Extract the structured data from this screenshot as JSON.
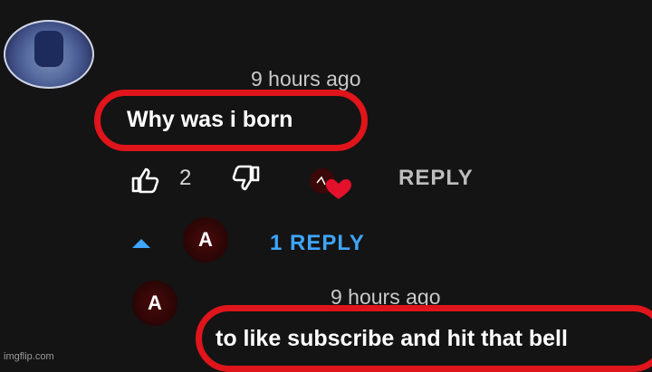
{
  "comment": {
    "timestamp": "9 hours ago",
    "text": "Why was i born",
    "like_count": "2",
    "reply_label": "REPLY",
    "view_replies_label": "1 REPLY",
    "reply_avatar_letter": "A"
  },
  "reply": {
    "avatar_letter": "A",
    "timestamp": "9 hours ago",
    "text": "to like subscribe and hit that bell"
  },
  "watermark": "imgflip.com",
  "colors": {
    "background": "#141414",
    "highlight": "#e0141b",
    "link": "#3ea6ff",
    "heart": "#e3112b"
  },
  "icons": [
    "like-icon",
    "dislike-icon",
    "creator-heart-icon",
    "caret-up-icon"
  ]
}
